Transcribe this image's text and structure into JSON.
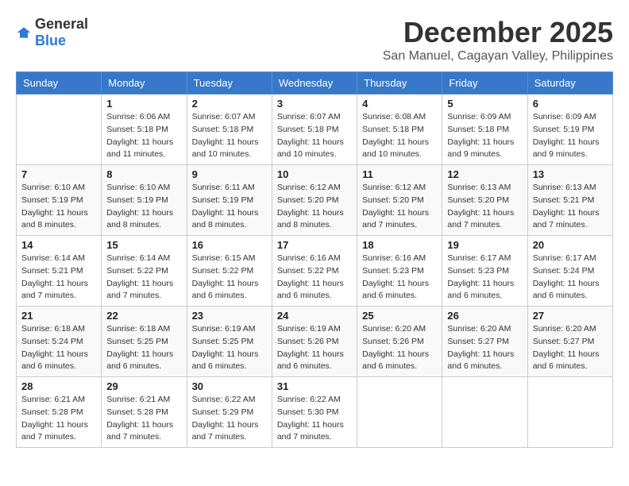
{
  "logo": {
    "general": "General",
    "blue": "Blue"
  },
  "title": "December 2025",
  "location": "San Manuel, Cagayan Valley, Philippines",
  "days_header": [
    "Sunday",
    "Monday",
    "Tuesday",
    "Wednesday",
    "Thursday",
    "Friday",
    "Saturday"
  ],
  "weeks": [
    [
      {
        "day": "",
        "sunrise": "",
        "sunset": "",
        "daylight": ""
      },
      {
        "day": "1",
        "sunrise": "Sunrise: 6:06 AM",
        "sunset": "Sunset: 5:18 PM",
        "daylight": "Daylight: 11 hours and 11 minutes."
      },
      {
        "day": "2",
        "sunrise": "Sunrise: 6:07 AM",
        "sunset": "Sunset: 5:18 PM",
        "daylight": "Daylight: 11 hours and 10 minutes."
      },
      {
        "day": "3",
        "sunrise": "Sunrise: 6:07 AM",
        "sunset": "Sunset: 5:18 PM",
        "daylight": "Daylight: 11 hours and 10 minutes."
      },
      {
        "day": "4",
        "sunrise": "Sunrise: 6:08 AM",
        "sunset": "Sunset: 5:18 PM",
        "daylight": "Daylight: 11 hours and 10 minutes."
      },
      {
        "day": "5",
        "sunrise": "Sunrise: 6:09 AM",
        "sunset": "Sunset: 5:18 PM",
        "daylight": "Daylight: 11 hours and 9 minutes."
      },
      {
        "day": "6",
        "sunrise": "Sunrise: 6:09 AM",
        "sunset": "Sunset: 5:19 PM",
        "daylight": "Daylight: 11 hours and 9 minutes."
      }
    ],
    [
      {
        "day": "7",
        "sunrise": "Sunrise: 6:10 AM",
        "sunset": "Sunset: 5:19 PM",
        "daylight": "Daylight: 11 hours and 8 minutes."
      },
      {
        "day": "8",
        "sunrise": "Sunrise: 6:10 AM",
        "sunset": "Sunset: 5:19 PM",
        "daylight": "Daylight: 11 hours and 8 minutes."
      },
      {
        "day": "9",
        "sunrise": "Sunrise: 6:11 AM",
        "sunset": "Sunset: 5:19 PM",
        "daylight": "Daylight: 11 hours and 8 minutes."
      },
      {
        "day": "10",
        "sunrise": "Sunrise: 6:12 AM",
        "sunset": "Sunset: 5:20 PM",
        "daylight": "Daylight: 11 hours and 8 minutes."
      },
      {
        "day": "11",
        "sunrise": "Sunrise: 6:12 AM",
        "sunset": "Sunset: 5:20 PM",
        "daylight": "Daylight: 11 hours and 7 minutes."
      },
      {
        "day": "12",
        "sunrise": "Sunrise: 6:13 AM",
        "sunset": "Sunset: 5:20 PM",
        "daylight": "Daylight: 11 hours and 7 minutes."
      },
      {
        "day": "13",
        "sunrise": "Sunrise: 6:13 AM",
        "sunset": "Sunset: 5:21 PM",
        "daylight": "Daylight: 11 hours and 7 minutes."
      }
    ],
    [
      {
        "day": "14",
        "sunrise": "Sunrise: 6:14 AM",
        "sunset": "Sunset: 5:21 PM",
        "daylight": "Daylight: 11 hours and 7 minutes."
      },
      {
        "day": "15",
        "sunrise": "Sunrise: 6:14 AM",
        "sunset": "Sunset: 5:22 PM",
        "daylight": "Daylight: 11 hours and 7 minutes."
      },
      {
        "day": "16",
        "sunrise": "Sunrise: 6:15 AM",
        "sunset": "Sunset: 5:22 PM",
        "daylight": "Daylight: 11 hours and 6 minutes."
      },
      {
        "day": "17",
        "sunrise": "Sunrise: 6:16 AM",
        "sunset": "Sunset: 5:22 PM",
        "daylight": "Daylight: 11 hours and 6 minutes."
      },
      {
        "day": "18",
        "sunrise": "Sunrise: 6:16 AM",
        "sunset": "Sunset: 5:23 PM",
        "daylight": "Daylight: 11 hours and 6 minutes."
      },
      {
        "day": "19",
        "sunrise": "Sunrise: 6:17 AM",
        "sunset": "Sunset: 5:23 PM",
        "daylight": "Daylight: 11 hours and 6 minutes."
      },
      {
        "day": "20",
        "sunrise": "Sunrise: 6:17 AM",
        "sunset": "Sunset: 5:24 PM",
        "daylight": "Daylight: 11 hours and 6 minutes."
      }
    ],
    [
      {
        "day": "21",
        "sunrise": "Sunrise: 6:18 AM",
        "sunset": "Sunset: 5:24 PM",
        "daylight": "Daylight: 11 hours and 6 minutes."
      },
      {
        "day": "22",
        "sunrise": "Sunrise: 6:18 AM",
        "sunset": "Sunset: 5:25 PM",
        "daylight": "Daylight: 11 hours and 6 minutes."
      },
      {
        "day": "23",
        "sunrise": "Sunrise: 6:19 AM",
        "sunset": "Sunset: 5:25 PM",
        "daylight": "Daylight: 11 hours and 6 minutes."
      },
      {
        "day": "24",
        "sunrise": "Sunrise: 6:19 AM",
        "sunset": "Sunset: 5:26 PM",
        "daylight": "Daylight: 11 hours and 6 minutes."
      },
      {
        "day": "25",
        "sunrise": "Sunrise: 6:20 AM",
        "sunset": "Sunset: 5:26 PM",
        "daylight": "Daylight: 11 hours and 6 minutes."
      },
      {
        "day": "26",
        "sunrise": "Sunrise: 6:20 AM",
        "sunset": "Sunset: 5:27 PM",
        "daylight": "Daylight: 11 hours and 6 minutes."
      },
      {
        "day": "27",
        "sunrise": "Sunrise: 6:20 AM",
        "sunset": "Sunset: 5:27 PM",
        "daylight": "Daylight: 11 hours and 6 minutes."
      }
    ],
    [
      {
        "day": "28",
        "sunrise": "Sunrise: 6:21 AM",
        "sunset": "Sunset: 5:28 PM",
        "daylight": "Daylight: 11 hours and 7 minutes."
      },
      {
        "day": "29",
        "sunrise": "Sunrise: 6:21 AM",
        "sunset": "Sunset: 5:28 PM",
        "daylight": "Daylight: 11 hours and 7 minutes."
      },
      {
        "day": "30",
        "sunrise": "Sunrise: 6:22 AM",
        "sunset": "Sunset: 5:29 PM",
        "daylight": "Daylight: 11 hours and 7 minutes."
      },
      {
        "day": "31",
        "sunrise": "Sunrise: 6:22 AM",
        "sunset": "Sunset: 5:30 PM",
        "daylight": "Daylight: 11 hours and 7 minutes."
      },
      {
        "day": "",
        "sunrise": "",
        "sunset": "",
        "daylight": ""
      },
      {
        "day": "",
        "sunrise": "",
        "sunset": "",
        "daylight": ""
      },
      {
        "day": "",
        "sunrise": "",
        "sunset": "",
        "daylight": ""
      }
    ]
  ]
}
